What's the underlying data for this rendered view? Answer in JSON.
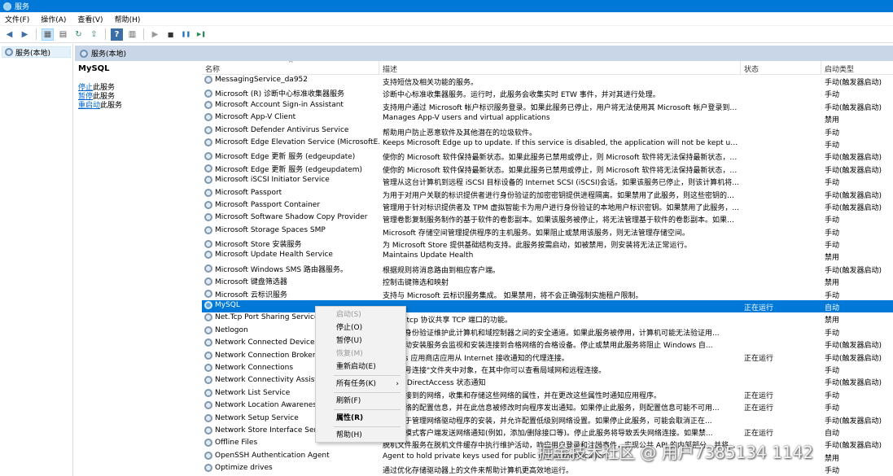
{
  "window": {
    "title": "服务"
  },
  "menu": [
    "文件(F)",
    "操作(A)",
    "查看(V)",
    "帮助(H)"
  ],
  "toolbar": {
    "icons": [
      "back-arrow-icon",
      "forward-arrow-icon",
      "console-tree-icon",
      "properties-icon",
      "refresh-icon",
      "export-list-icon",
      "help-icon",
      "action-pane-icon",
      "start-icon",
      "stop-icon",
      "pause-icon",
      "restart-icon"
    ],
    "glyphs": [
      "◀",
      "▶",
      "▦",
      "▤",
      "↻",
      "⇪",
      "?",
      "▥",
      "▶",
      "■",
      "❚❚",
      "▶❚"
    ]
  },
  "tree": {
    "root": "服务(本地)"
  },
  "header": {
    "title": "服务(本地)"
  },
  "detail": {
    "service_name": "MySQL",
    "actions": [
      {
        "link": "停止",
        "suffix": "此服务"
      },
      {
        "link": "暂停",
        "suffix": "此服务"
      },
      {
        "link": "重启动",
        "suffix": "此服务"
      }
    ]
  },
  "columns": {
    "name": "名称",
    "desc": "描述",
    "state": "状态",
    "start": "启动类型"
  },
  "rows": [
    {
      "name": "MessagingService_da952",
      "desc": "支持短信及相关功能的服务。",
      "state": "",
      "start": "手动(触发器启动)"
    },
    {
      "name": "Microsoft (R) 诊断中心标准收集器服务",
      "desc": "诊断中心标准收集器服务。运行时，此服务会收集实时 ETW 事件，并对其进行处理。",
      "state": "",
      "start": "手动"
    },
    {
      "name": "Microsoft Account Sign-in Assistant",
      "desc": "支持用户通过 Microsoft 帐户标识服务登录。如果此服务已停止，用户将无法使用其 Microsoft 帐户登录到此...",
      "state": "",
      "start": "手动(触发器启动)"
    },
    {
      "name": "Microsoft App-V Client",
      "desc": "Manages App-V users and virtual applications",
      "state": "",
      "start": "禁用"
    },
    {
      "name": "Microsoft Defender Antivirus Service",
      "desc": "帮助用户防止恶意软件及其他潜在的垃圾软件。",
      "state": "",
      "start": "手动"
    },
    {
      "name": "Microsoft Edge Elevation Service (MicrosoftE...",
      "desc": "Keeps Microsoft Edge up to update. If this service is disabled, the application will not be kept up to...",
      "state": "",
      "start": "手动"
    },
    {
      "name": "Microsoft Edge 更新 服务 (edgeupdate)",
      "desc": "使你的 Microsoft 软件保持最新状态。如果此服务已禁用或停止，则 Microsoft 软件将无法保持最新状态，这...",
      "state": "",
      "start": "手动(触发器启动)"
    },
    {
      "name": "Microsoft Edge 更新 服务 (edgeupdatem)",
      "desc": "使你的 Microsoft 软件保持最新状态。如果此服务已禁用或停止，则 Microsoft 软件将无法保持最新状态，这...",
      "state": "",
      "start": "手动(触发器启动)"
    },
    {
      "name": "Microsoft iSCSI Initiator Service",
      "desc": "管理从这台计算机到远程 iSCSI 目标设备的 Internet SCSI (iSCSI)会话。如果该服务已停止，则该计算机将无...",
      "state": "",
      "start": "手动"
    },
    {
      "name": "Microsoft Passport",
      "desc": "为用于对用户关联的标识提供者进行身份验证的加密密钥提供进程隔离。如果禁用了此服务，则这些密钥的所...",
      "state": "",
      "start": "手动(触发器启动)"
    },
    {
      "name": "Microsoft Passport Container",
      "desc": "管理用于针对标识提供者及 TPM 虚拟智能卡为用户进行身份验证的本地用户标识密钥。如果禁用了此服务，...",
      "state": "",
      "start": "手动(触发器启动)"
    },
    {
      "name": "Microsoft Software Shadow Copy Provider",
      "desc": "管理卷影复制服务制作的基于软件的卷影副本。如果该服务被停止，将无法管理基于软件的卷影副本。如果该...",
      "state": "",
      "start": "手动"
    },
    {
      "name": "Microsoft Storage Spaces SMP",
      "desc": "Microsoft 存储空间管理提供程序的主机服务。如果阻止或禁用该服务，则无法管理存储空间。",
      "state": "",
      "start": "手动"
    },
    {
      "name": "Microsoft Store 安装服务",
      "desc": "为 Microsoft Store 提供基础结构支持。此服务按需启动，如被禁用，则安装将无法正常运行。",
      "state": "",
      "start": "手动"
    },
    {
      "name": "Microsoft Update Health Service",
      "desc": "Maintains Update Health",
      "state": "",
      "start": "禁用"
    },
    {
      "name": "Microsoft Windows SMS 路由器服务。",
      "desc": "根据规则将消息路由到相应客户端。",
      "state": "",
      "start": "手动(触发器启动)"
    },
    {
      "name": "Microsoft 键盘筛选器",
      "desc": "控制击键筛选和映射",
      "state": "",
      "start": "禁用"
    },
    {
      "name": "Microsoft 云标识服务",
      "desc": "支持与 Microsoft 云标识服务集成。 如果禁用，将不会正确强制实施租户限制。",
      "state": "",
      "start": "手动"
    },
    {
      "name": "MySQL",
      "desc": "",
      "state": "正在运行",
      "start": "自动"
    },
    {
      "name": "Net.Tcp Port Sharing Service",
      "desc": "过 net.tcp 协议共享 TCP 端口的功能。",
      "state": "",
      "start": "禁用"
    },
    {
      "name": "Netlogon",
      "desc": "和服务身份验证维护此计算机和域控制器之间的安全通道。如果此服务被停用，计算机可能无法验证用...",
      "state": "",
      "start": "手动"
    },
    {
      "name": "Network Connected Devices ...",
      "desc": "设备自动安装服务会监视和安装连接到合格网络的合格设备。停止或禁用此服务将阻止 Windows 自...",
      "state": "",
      "start": "手动(触发器启动)"
    },
    {
      "name": "Network Connection Broker",
      "desc": "indows 应用商店应用从 Internet 接收通知的代理连接。",
      "state": "正在运行",
      "start": "手动(触发器启动)"
    },
    {
      "name": "Network Connections",
      "desc": "络和拨号连接\"文件夹中对象，在其中你可以查看局域网和远程连接。",
      "state": "",
      "start": "手动"
    },
    {
      "name": "Network Connectivity Assista...",
      "desc": "组件的 DirectAccess 状态通知",
      "state": "",
      "start": "手动(触发器启动)"
    },
    {
      "name": "Network List Service",
      "desc": "机已连接到的网络，收集和存储这些网络的属性，并在更改这些属性时通知应用程序。",
      "state": "正在运行",
      "start": "手动"
    },
    {
      "name": "Network Location Awareness",
      "desc": "存储网络的配置信息，并在此信息被修改时向程序发出通知。如果停止此服务，则配置信息可能不可用...",
      "state": "正在运行",
      "start": "手动"
    },
    {
      "name": "Network Setup Service",
      "desc": "服务用于管理网络驱动程序的安装，并允许配置低级别网络设置。如果停止此服务，可能会取消正在...",
      "state": "",
      "start": "手动(触发器启动)"
    },
    {
      "name": "Network Store Interface Serv...",
      "desc": "向用户模式客户端发送网络通知(例如，添加/删除接口等)。停止此服务将导致丢失网络连接。如果禁...",
      "state": "正在运行",
      "start": "自动"
    },
    {
      "name": "Offline Files",
      "desc": "脱机文件服务在脱机文件缓存中执行维护活动，响应用户登录和注销事件，实现公共 API 的内部部分，并将...",
      "state": "",
      "start": "手动(触发器启动)"
    },
    {
      "name": "OpenSSH Authentication Agent",
      "desc": "Agent to hold private keys used for public key authentication.",
      "state": "",
      "start": "禁用"
    },
    {
      "name": "Optimize drives",
      "desc": "通过优化存储驱动器上的文件来帮助计算机更高效地运行。",
      "state": "",
      "start": "手动"
    }
  ],
  "context_menu": {
    "items": [
      {
        "label": "启动(S)",
        "disabled": true,
        "bold": false,
        "sep_after": false,
        "submenu": false
      },
      {
        "label": "停止(O)",
        "disabled": false,
        "bold": false,
        "sep_after": false,
        "submenu": false
      },
      {
        "label": "暂停(U)",
        "disabled": false,
        "bold": false,
        "sep_after": false,
        "submenu": false
      },
      {
        "label": "恢复(M)",
        "disabled": true,
        "bold": false,
        "sep_after": false,
        "submenu": false
      },
      {
        "label": "重新启动(E)",
        "disabled": false,
        "bold": false,
        "sep_after": true,
        "submenu": false
      },
      {
        "label": "所有任务(K)",
        "disabled": false,
        "bold": false,
        "sep_after": true,
        "submenu": true
      },
      {
        "label": "刷新(F)",
        "disabled": false,
        "bold": false,
        "sep_after": true,
        "submenu": false
      },
      {
        "label": "属性(R)",
        "disabled": false,
        "bold": true,
        "sep_after": true,
        "submenu": false
      },
      {
        "label": "帮助(H)",
        "disabled": false,
        "bold": false,
        "sep_after": false,
        "submenu": false
      }
    ],
    "submenu_glyph": "›"
  },
  "watermark": "掘金技术社区 @ 用户7385134 1142",
  "colors": {
    "titlebar": "#0078d7",
    "selected_row": "#0078d7",
    "header_band": "#c9d6e7",
    "link": "#0066cc"
  }
}
